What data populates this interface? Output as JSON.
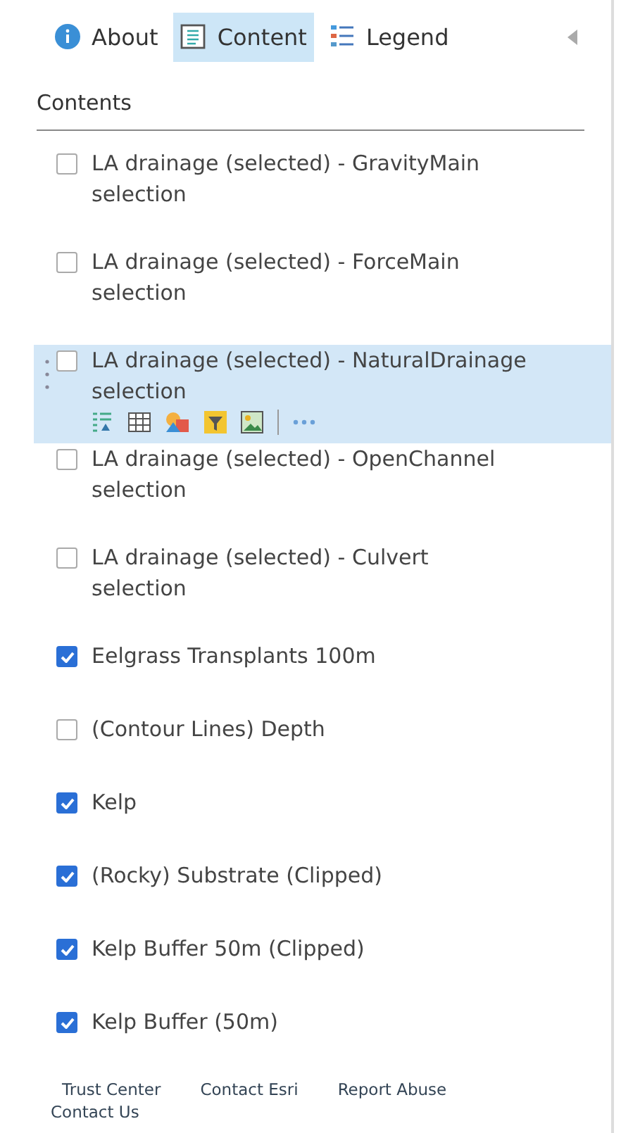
{
  "tabs": [
    {
      "label": "About",
      "selected": false
    },
    {
      "label": "Content",
      "selected": true
    },
    {
      "label": "Legend",
      "selected": false
    }
  ],
  "panel_title": "Contents",
  "layers": [
    {
      "name": "LA drainage (selected) - GravityMain selection",
      "checked": false,
      "selected": false
    },
    {
      "name": "LA drainage (selected) - ForceMain selection",
      "checked": false,
      "selected": false
    },
    {
      "name": "LA drainage (selected) - NaturalDrainage selection",
      "checked": false,
      "selected": true
    },
    {
      "name": "LA drainage (selected) - OpenChannel selection",
      "checked": false,
      "selected": false
    },
    {
      "name": "LA drainage (selected) - Culvert selection",
      "checked": false,
      "selected": false
    },
    {
      "name": "Eelgrass Transplants 100m",
      "checked": true,
      "selected": false
    },
    {
      "name": "(Contour Lines) Depth",
      "checked": false,
      "selected": false
    },
    {
      "name": "Kelp",
      "checked": true,
      "selected": false
    },
    {
      "name": "(Rocky) Substrate (Clipped)",
      "checked": true,
      "selected": false
    },
    {
      "name": "Kelp Buffer 50m (Clipped)",
      "checked": true,
      "selected": false
    },
    {
      "name": "Kelp Buffer (50m)",
      "checked": true,
      "selected": false
    }
  ],
  "footer_links": [
    "Trust Center",
    "Contact Esri",
    "Report Abuse",
    "Contact Us"
  ]
}
